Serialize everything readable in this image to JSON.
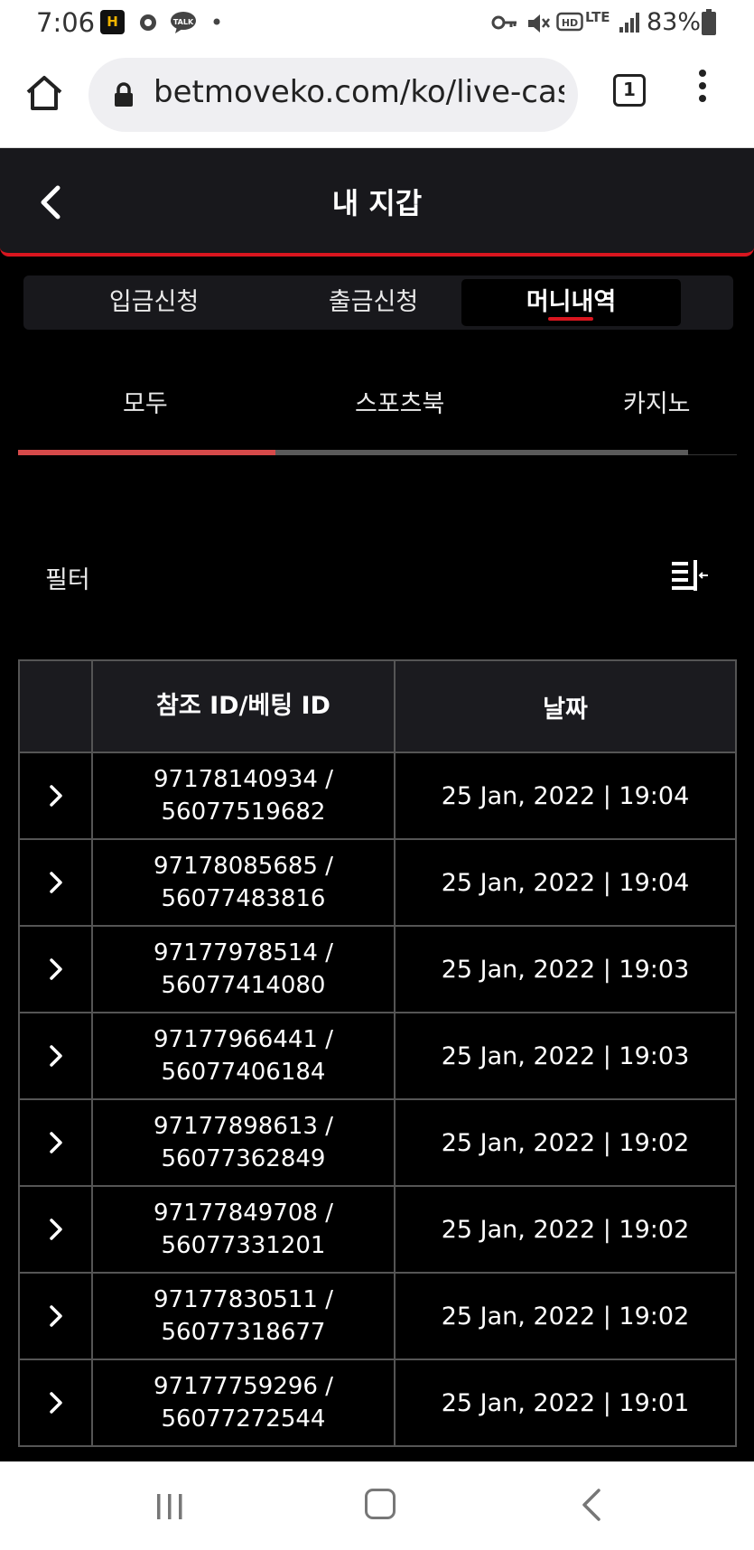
{
  "status_bar": {
    "time": "7:06",
    "app_icon_letter": "H",
    "battery": "83%",
    "network": "LTE"
  },
  "browser": {
    "url": "betmoveko.com/ko/live-casino",
    "tab_count": "1"
  },
  "header": {
    "title": "내 지갑"
  },
  "wallet_tabs": [
    {
      "label": "입금신청"
    },
    {
      "label": "출금신청"
    },
    {
      "label": "머니내역"
    }
  ],
  "category_tabs": [
    {
      "label": "모두"
    },
    {
      "label": "스포츠북"
    },
    {
      "label": "카지노"
    }
  ],
  "filter": {
    "label": "필터"
  },
  "table": {
    "headers": [
      "",
      "참조 ID/베팅 ID",
      "날짜"
    ],
    "rows": [
      {
        "ref_id": "97178140934 /",
        "bet_id": "56077519682",
        "date": "25 Jan, 2022 | 19:04"
      },
      {
        "ref_id": "97178085685 /",
        "bet_id": "56077483816",
        "date": "25 Jan, 2022 | 19:04"
      },
      {
        "ref_id": "97177978514 /",
        "bet_id": "56077414080",
        "date": "25 Jan, 2022 | 19:03"
      },
      {
        "ref_id": "97177966441 /",
        "bet_id": "56077406184",
        "date": "25 Jan, 2022 | 19:03"
      },
      {
        "ref_id": "97177898613 /",
        "bet_id": "56077362849",
        "date": "25 Jan, 2022 | 19:02"
      },
      {
        "ref_id": "97177849708 /",
        "bet_id": "56077331201",
        "date": "25 Jan, 2022 | 19:02"
      },
      {
        "ref_id": "97177830511 /",
        "bet_id": "56077318677",
        "date": "25 Jan, 2022 | 19:02"
      },
      {
        "ref_id": "97177759296 /",
        "bet_id": "56077272544",
        "date": "25 Jan, 2022 | 19:01"
      }
    ]
  },
  "colors": {
    "accent": "#d9161f",
    "background": "#000000",
    "header_bg": "#18181c",
    "border": "#555555"
  }
}
